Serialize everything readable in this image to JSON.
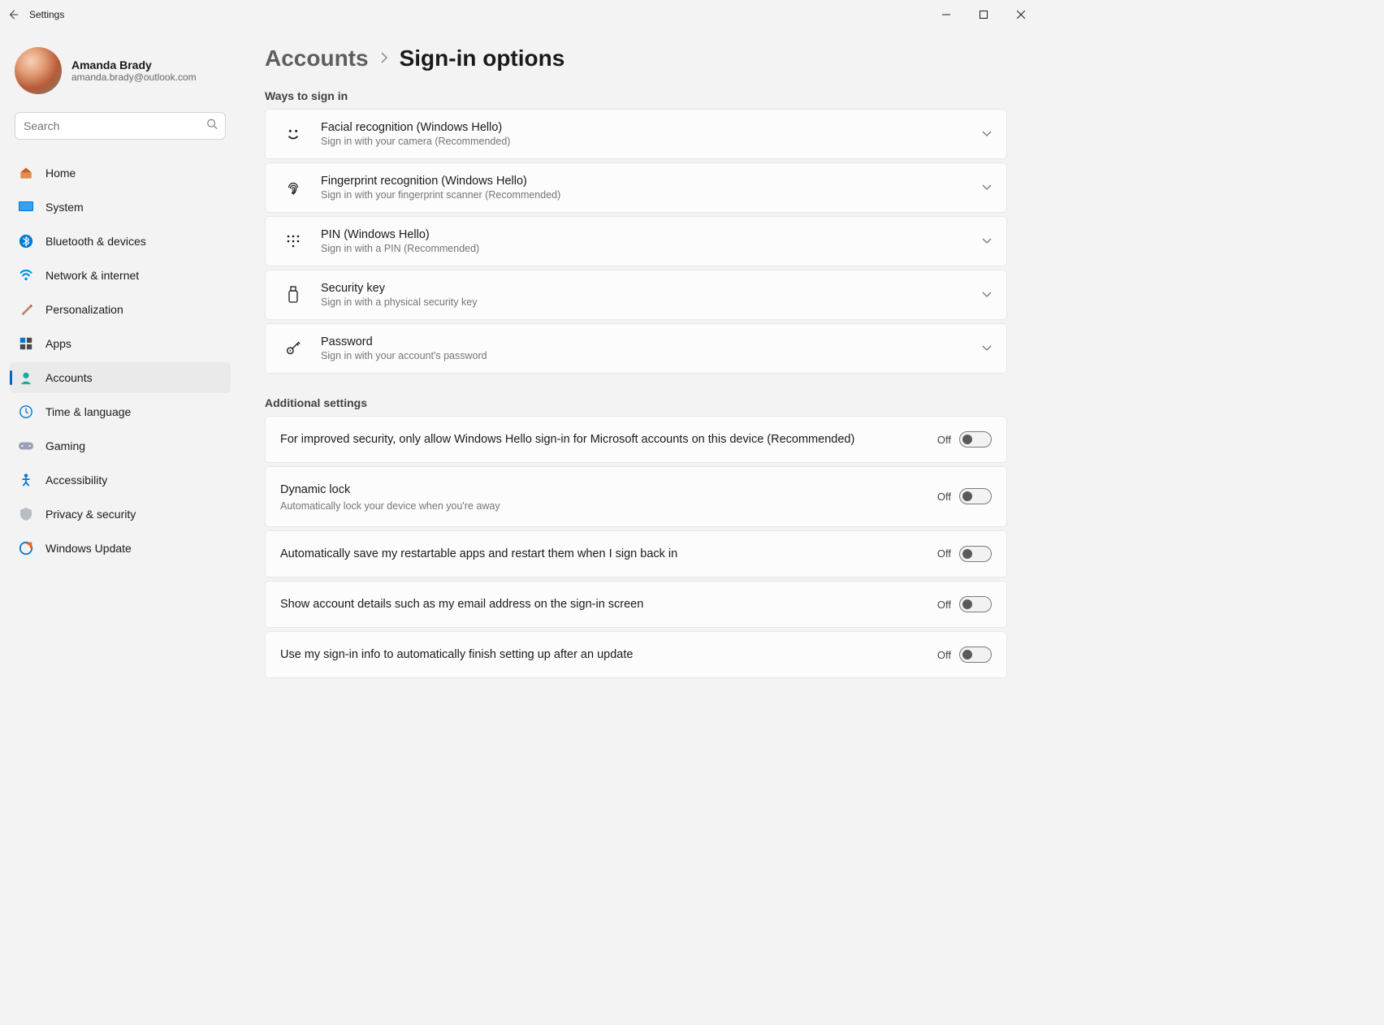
{
  "titlebar": {
    "title": "Settings"
  },
  "profile": {
    "name": "Amanda Brady",
    "email": "amanda.brady@outlook.com"
  },
  "search": {
    "placeholder": "Search"
  },
  "nav": {
    "items": [
      {
        "label": "Home"
      },
      {
        "label": "System"
      },
      {
        "label": "Bluetooth & devices"
      },
      {
        "label": "Network & internet"
      },
      {
        "label": "Personalization"
      },
      {
        "label": "Apps"
      },
      {
        "label": "Accounts"
      },
      {
        "label": "Time & language"
      },
      {
        "label": "Gaming"
      },
      {
        "label": "Accessibility"
      },
      {
        "label": "Privacy & security"
      },
      {
        "label": "Windows Update"
      }
    ]
  },
  "breadcrumb": {
    "parent": "Accounts",
    "current": "Sign-in options"
  },
  "sections": {
    "ways_header": "Ways to sign in",
    "additional_header": "Additional settings"
  },
  "signin": [
    {
      "title": "Facial recognition (Windows Hello)",
      "sub": "Sign in with your camera (Recommended)"
    },
    {
      "title": "Fingerprint recognition (Windows Hello)",
      "sub": "Sign in with your fingerprint scanner (Recommended)"
    },
    {
      "title": "PIN (Windows Hello)",
      "sub": "Sign in with a PIN (Recommended)"
    },
    {
      "title": "Security key",
      "sub": "Sign in with a physical security key"
    },
    {
      "title": "Password",
      "sub": "Sign in with your account's password"
    }
  ],
  "toggles": [
    {
      "title": "For improved security, only allow Windows Hello sign-in for Microsoft accounts on this device (Recommended)",
      "sub": "",
      "state": "Off"
    },
    {
      "title": "Dynamic lock",
      "sub": "Automatically lock your device when you're away",
      "state": "Off"
    },
    {
      "title": "Automatically save my restartable apps and restart them when I sign back in",
      "sub": "",
      "state": "Off"
    },
    {
      "title": "Show account details such as my email address on the sign-in screen",
      "sub": "",
      "state": "Off"
    },
    {
      "title": "Use my sign-in info to automatically finish setting up after an update",
      "sub": "",
      "state": "Off"
    }
  ]
}
